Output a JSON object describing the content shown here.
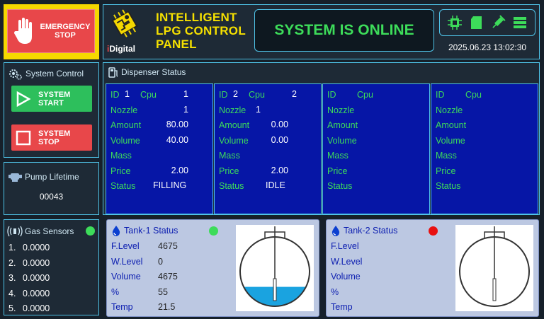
{
  "emergency": {
    "label_line1": "EMERGENCY",
    "label_line2": "STOP"
  },
  "header": {
    "brand": {
      "prefix": "i",
      "name": "Digital"
    },
    "title_lines": [
      "INTELLIGENT",
      "LPG CONTROL",
      "PANEL"
    ],
    "online_text": "SYSTEM IS ONLINE",
    "datetime": "2025.06.23 13:02:30",
    "status_icons": [
      "cpu-icon",
      "sd-card-icon",
      "syringe-icon",
      "server-icon"
    ]
  },
  "system_control": {
    "title": "System Control",
    "start_line1": "SYSTEM",
    "start_line2": "START",
    "stop_line1": "SYSTEM",
    "stop_line2": "STOP"
  },
  "pump": {
    "title": "Pump Lifetime",
    "value": "00043"
  },
  "gas": {
    "title": "Gas Sensors",
    "status_color": "#3ddc5a",
    "sensors": [
      {
        "index": "1.",
        "value": "0.0000"
      },
      {
        "index": "2.",
        "value": "0.0000"
      },
      {
        "index": "3.",
        "value": "0.0000"
      },
      {
        "index": "4.",
        "value": "0.0000"
      },
      {
        "index": "5.",
        "value": "0.0000"
      }
    ]
  },
  "dispenser": {
    "title": "Dispenser Status",
    "labels": {
      "id": "ID",
      "cpu": "Cpu",
      "nozzle": "Nozzle",
      "amount": "Amount",
      "volume": "Volume",
      "mass": "Mass",
      "price": "Price",
      "status": "Status"
    },
    "cards": [
      {
        "id": "1",
        "cpu": "1",
        "nozzle": "1",
        "amount": "80.00",
        "volume": "40.00",
        "mass": "",
        "price": "2.00",
        "status": "FILLING"
      },
      {
        "id": "2",
        "cpu": "2",
        "nozzle": "1",
        "amount": "0.00",
        "volume": "0.00",
        "mass": "",
        "price": "2.00",
        "status": "IDLE"
      },
      {
        "id": "",
        "cpu": "",
        "nozzle": "",
        "amount": "",
        "volume": "",
        "mass": "",
        "price": "",
        "status": ""
      },
      {
        "id": "",
        "cpu": "",
        "nozzle": "",
        "amount": "",
        "volume": "",
        "mass": "",
        "price": "",
        "status": ""
      }
    ]
  },
  "tanks": [
    {
      "title": "Tank-1 Status",
      "status_color": "#3ddc5a",
      "fill_fraction": 0.28,
      "labels": [
        "F.Level",
        "W.Level",
        "Volume",
        "%",
        "Temp"
      ],
      "values": [
        "4675",
        "0",
        "4675",
        "55",
        "21.5"
      ]
    },
    {
      "title": "Tank-2 Status",
      "status_color": "#e81010",
      "fill_fraction": 0,
      "labels": [
        "F.Level",
        "W.Level",
        "Volume",
        "%",
        "Temp"
      ],
      "values": [
        "",
        "",
        "",
        "",
        ""
      ]
    }
  ]
}
